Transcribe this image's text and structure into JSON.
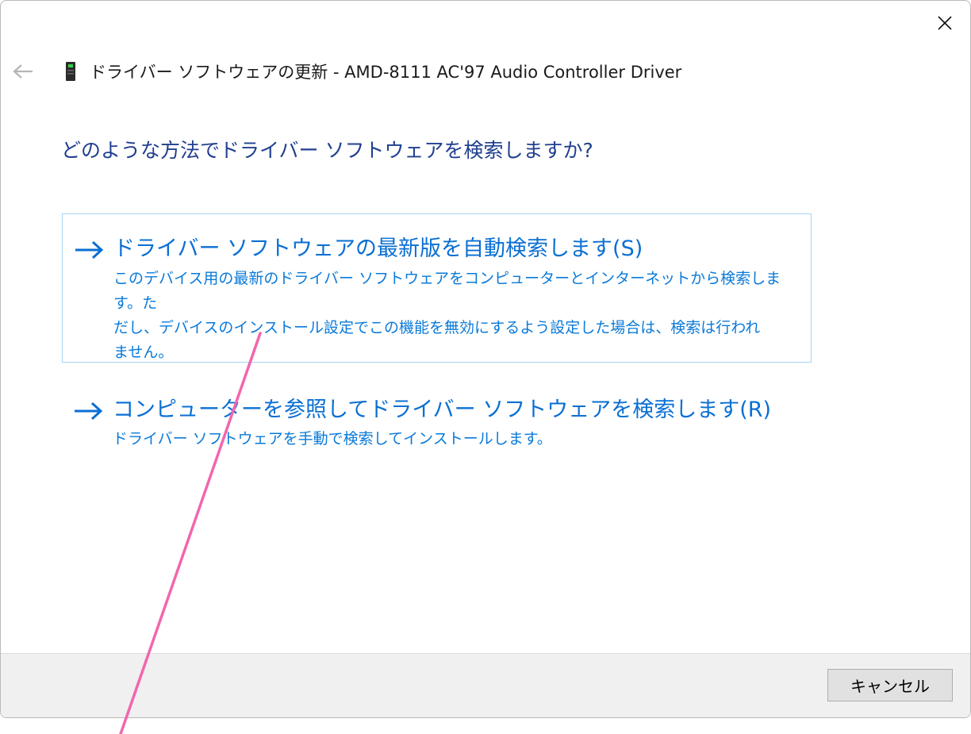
{
  "window": {
    "title": "ドライバー ソフトウェアの更新 - AMD-8111 AC'97 Audio Controller Driver"
  },
  "main": {
    "question": "どのような方法でドライバー ソフトウェアを検索しますか?",
    "options": [
      {
        "title": "ドライバー ソフトウェアの最新版を自動検索します(S)",
        "description": "このデバイス用の最新のドライバー ソフトウェアをコンピューターとインターネットから検索します。た\nだし、デバイスのインストール設定でこの機能を無効にするよう設定した場合は、検索は行われ\nません。"
      },
      {
        "title": "コンピューターを参照してドライバー ソフトウェアを検索します(R)",
        "description": "ドライバー ソフトウェアを手動で検索してインストールします。"
      }
    ]
  },
  "footer": {
    "cancel_label": "キャンセル"
  },
  "icons": {
    "close": "close-icon",
    "back": "back-arrow-icon",
    "device": "device-icon",
    "option_arrow": "arrow-right-icon"
  },
  "colors": {
    "link_blue": "#0a6fd3",
    "heading_blue": "#1f3f8f",
    "selected_border": "#a6d6ef",
    "annotation_pink": "#f266ad"
  }
}
